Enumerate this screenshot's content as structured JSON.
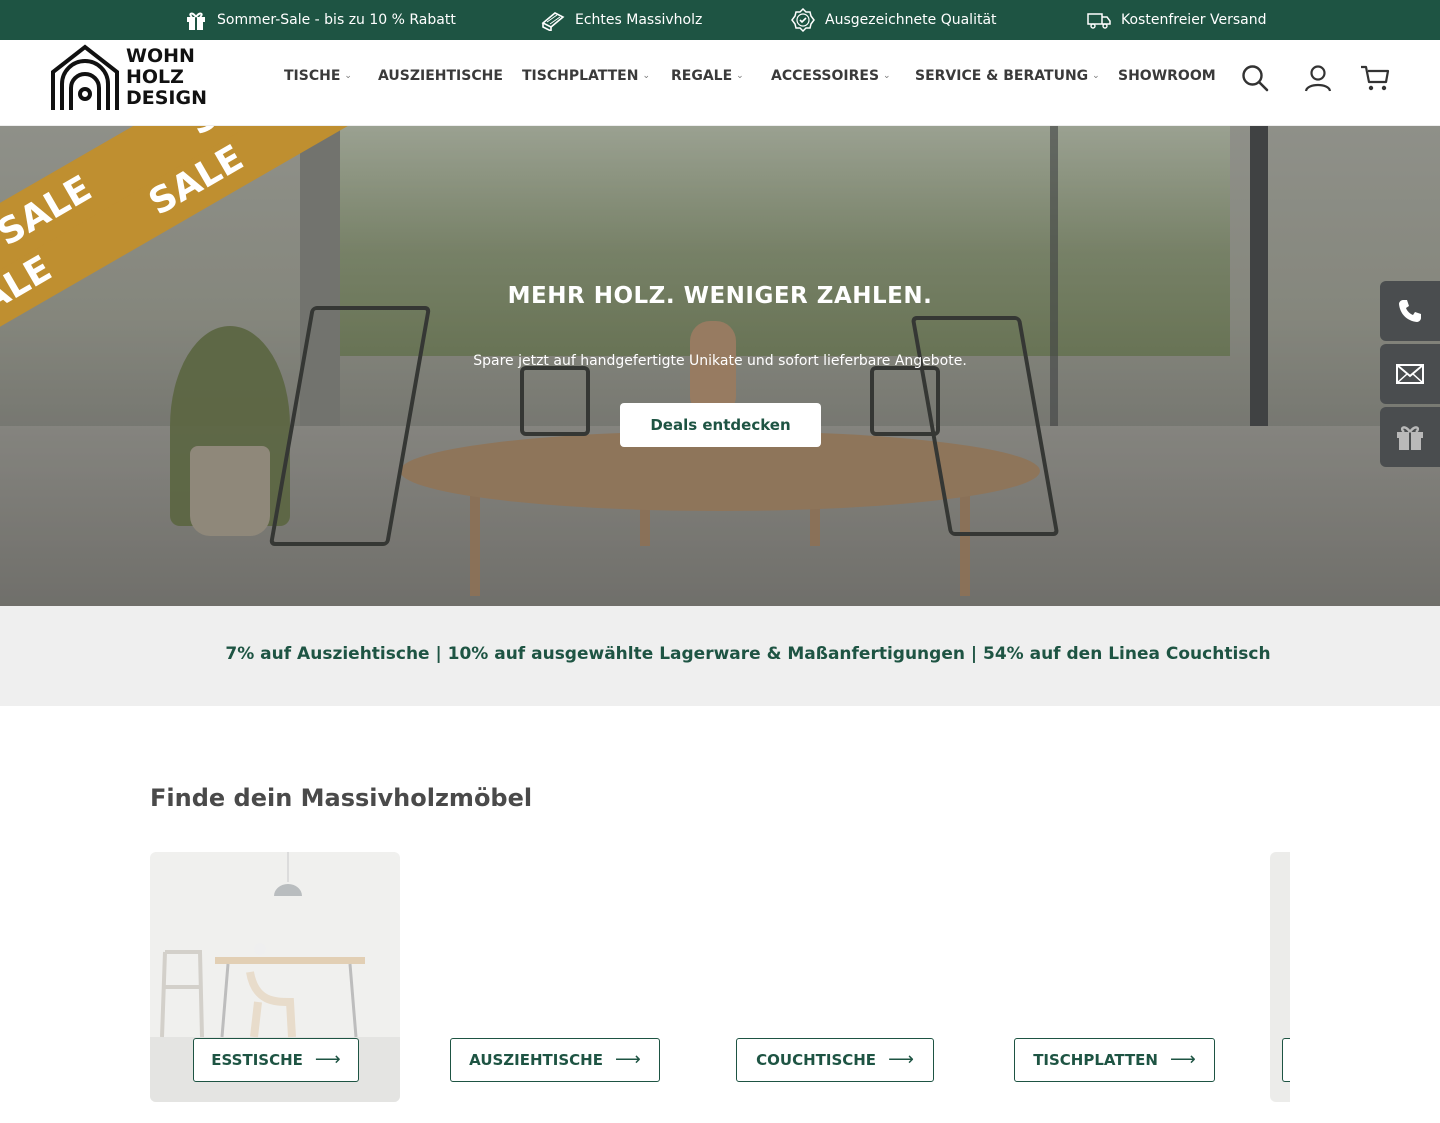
{
  "topbar": {
    "usps": [
      {
        "label": "Sommer-Sale - bis zu 10 % Rabatt",
        "icon": "gift-icon"
      },
      {
        "label": "Echtes Massivholz",
        "icon": "wood-plank-icon"
      },
      {
        "label": "Ausgezeichnete Qualität",
        "icon": "quality-badge-icon"
      },
      {
        "label": "Kostenfreier Versand",
        "icon": "delivery-truck-icon"
      }
    ]
  },
  "header": {
    "logo": {
      "line1": "WOHN",
      "line2": "HOLZ",
      "line3": "DESIGN"
    },
    "nav": [
      {
        "label": "TISCHE",
        "has_dropdown": true
      },
      {
        "label": "AUSZIEHTISCHE",
        "has_dropdown": false
      },
      {
        "label": "TISCHPLATTEN",
        "has_dropdown": true
      },
      {
        "label": "REGALE",
        "has_dropdown": true
      },
      {
        "label": "ACCESSOIRES",
        "has_dropdown": true
      },
      {
        "label": "SERVICE & BERATUNG",
        "has_dropdown": true
      },
      {
        "label": "SHOWROOM",
        "has_dropdown": false
      }
    ],
    "chevron": "⌄",
    "icons": [
      "search-icon",
      "account-icon",
      "cart-icon"
    ]
  },
  "hero": {
    "ribbon_text": "SALE",
    "title": "MEHR HOLZ. WENIGER ZAHLEN.",
    "subtitle": "Spare jetzt auf handgefertigte Unikate und sofort lieferbare Angebote.",
    "cta": "Deals entdecken"
  },
  "side_tabs": [
    "phone-icon",
    "mail-icon",
    "gift-icon"
  ],
  "promo": {
    "text": "7% auf Ausziehtische | 10% auf ausgewählte Lagerware & Maßanfertigungen | 54% auf den Linea Couchtisch"
  },
  "categories": {
    "title": "Finde dein Massivholzmöbel",
    "items": [
      {
        "label": "ESSTISCHE"
      },
      {
        "label": "AUSZIEHTISCHE"
      },
      {
        "label": "COUCHTISCHE"
      },
      {
        "label": "TISCHPLATTEN"
      }
    ],
    "arrow": "⟶"
  },
  "colors": {
    "brand_green": "#1e5443",
    "sale_gold": "#bf8f30",
    "promo_bg": "#efefef",
    "side_tab_bg": "#4a4d4f"
  }
}
